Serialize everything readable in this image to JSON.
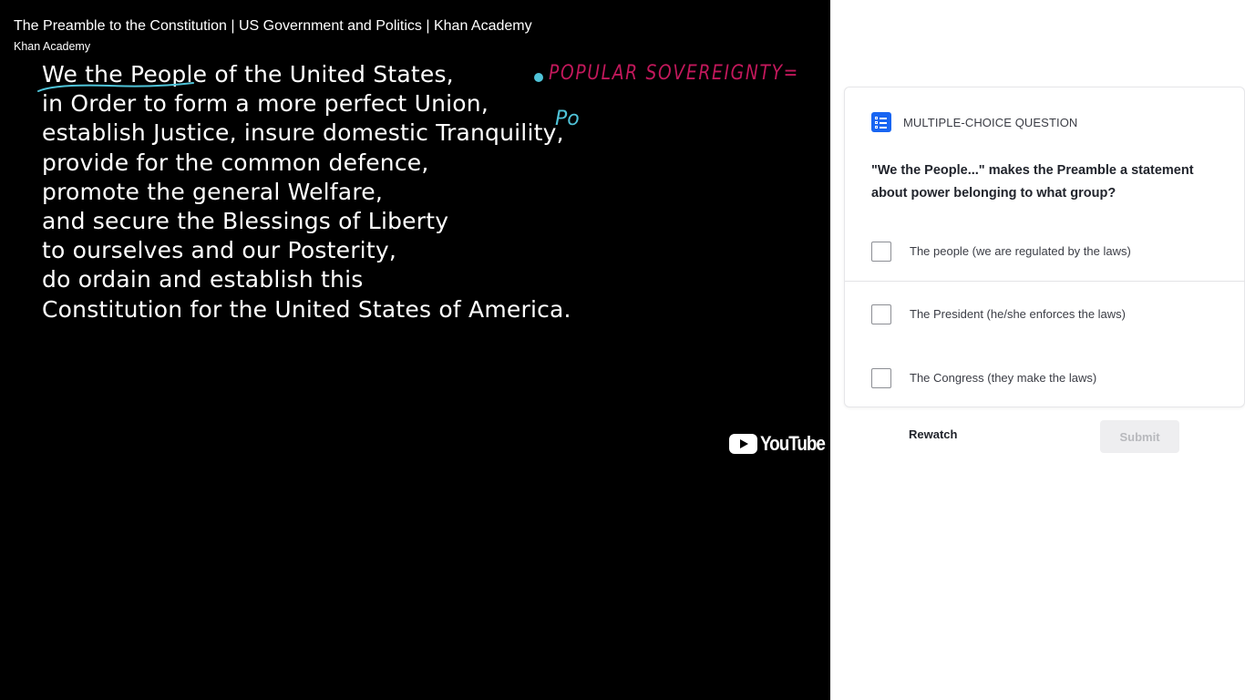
{
  "video": {
    "title": "The Preamble to the Constitution | US Government and Politics | Khan Academy",
    "channel": "Khan Academy",
    "preamble_lines": [
      "We the People of the United States,",
      "in Order to form a more perfect Union,",
      "establish Justice, insure domestic Tranquility,",
      "provide for the common defence,",
      "promote the general Welfare,",
      "and secure the Blessings of Liberty",
      "to ourselves and our Posterity,",
      "do ordain and establish this",
      "Constitution for the United States of America."
    ],
    "handwriting": {
      "line1": "POPULAR SOVEREIGNTY=",
      "line2": "Po",
      "color_main": "#c2185b",
      "color_accent": "#4fc3d8"
    },
    "logo_text": "YouTube"
  },
  "question": {
    "type_label": "MULTIPLE-CHOICE QUESTION",
    "prompt": "\"We the People...\" makes the Preamble a statement about power belonging to what group?",
    "choices": [
      {
        "label": "The people (we are regulated by the laws)",
        "checked": false
      },
      {
        "label": "The President (he/she enforces the laws)",
        "checked": false
      },
      {
        "label": "The Congress (they make the laws)",
        "checked": false
      }
    ]
  },
  "actions": {
    "rewatch_label": "Rewatch",
    "submit_label": "Submit"
  },
  "colors": {
    "accent": "#1865f2",
    "video_bg": "#000000"
  }
}
